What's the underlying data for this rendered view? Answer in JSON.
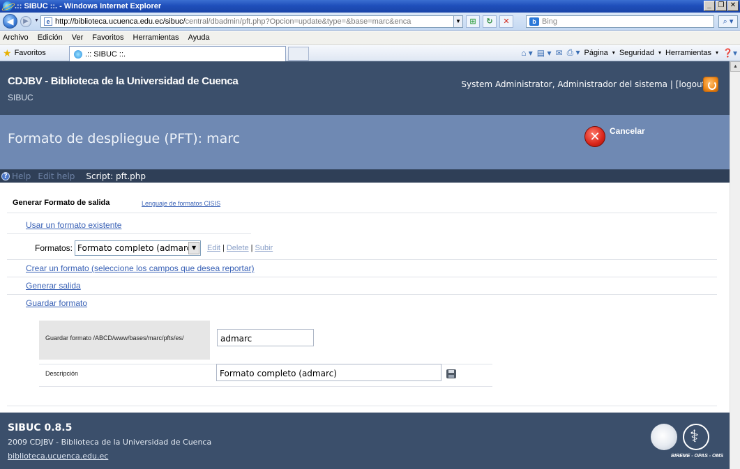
{
  "browser": {
    "window_title": ".:: SIBUC ::. - Windows Internet Explorer",
    "url_main": "http://biblioteca.ucuenca.edu.ec/sibuc/",
    "url_rest": "central/dbadmin/pft.php?Opcion=update&type=&base=marc&enca",
    "search_placeholder": "Bing",
    "menu": [
      "Archivo",
      "Edición",
      "Ver",
      "Favoritos",
      "Herramientas",
      "Ayuda"
    ],
    "favorites_label": "Favoritos",
    "tab_title": ".:: SIBUC ::.",
    "command_bar": {
      "page": "Página",
      "security": "Seguridad",
      "tools": "Herramientas"
    }
  },
  "header": {
    "site_title": "CDJBV - Biblioteca de la Universidad de Cuenca",
    "site_subtitle": "SIBUC",
    "user_text": "System Administrator, Administrador del sistema | [logout]"
  },
  "section": {
    "title": "Formato de despliegue (PFT): marc",
    "cancel_label": "Cancelar"
  },
  "helpbar": {
    "help": "Help",
    "edit_help": "Edit help",
    "script": "Script: pft.php"
  },
  "main": {
    "heading": "Generar Formato de salida",
    "lang_link": "Lenguaje de formatos CISIS",
    "use_existing": "Usar un formato existente",
    "formats_label": "Formatos:",
    "formats_selected": "Formato completo (admarc)",
    "edit": "Edit",
    "delete": "Delete",
    "upload": "Subir",
    "create_format": "Crear un formato (seleccione los campos que desea reportar)",
    "generate_output": "Generar salida",
    "save_format": "Guardar formato",
    "save_path_label": "Guardar formato /ABCD/www/bases/marc/pfts/es/",
    "save_name_value": "admarc",
    "description_label": "Descripción",
    "description_value": "Formato completo (admarc)"
  },
  "footer": {
    "version": "SIBUC 0.8.5",
    "copyright": "2009 CDJBV - Biblioteca de la Universidad de Cuenca",
    "site_link": "biblioteca.ucuenca.edu.ec",
    "logo_text": "BIREME - OPAS - OMS"
  },
  "colors": {
    "header_bg": "#3b4f6b",
    "section_bg": "#6f89b3",
    "link": "#3a62b6"
  }
}
